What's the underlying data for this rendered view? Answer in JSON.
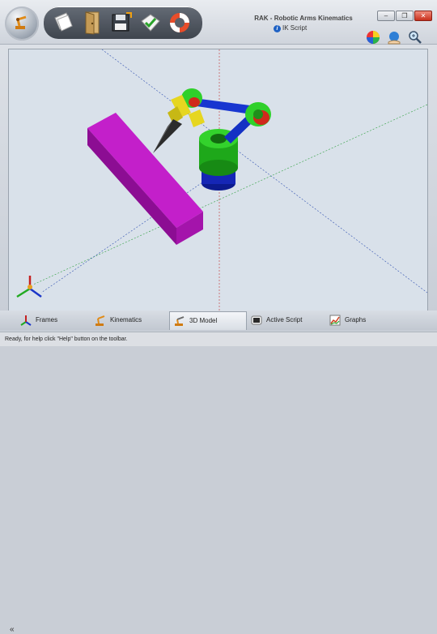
{
  "app": {
    "title": "RAK - Robotic Arms Kinematics",
    "mode": "IK Script"
  },
  "toolbar": {
    "buttons": [
      {
        "icon": "new-document-icon"
      },
      {
        "icon": "open-door-icon"
      },
      {
        "icon": "save-printer-icon"
      },
      {
        "icon": "check-arrow-icon"
      },
      {
        "icon": "lifebuoy-help-icon"
      }
    ]
  },
  "window_controls": {
    "minimize": "–",
    "restore": "❐",
    "close": "✕"
  },
  "view_tools": [
    {
      "icon": "color-wheel-icon"
    },
    {
      "icon": "globe-hand-icon"
    },
    {
      "icon": "zoom-magnifier-icon"
    }
  ],
  "tabs": {
    "scroll_left": "«",
    "items": [
      {
        "label": "Frames",
        "icon": "frames-icon",
        "active": false
      },
      {
        "label": "Kinematics",
        "icon": "kinematics-icon",
        "active": false
      },
      {
        "label": "3D Model",
        "icon": "3d-model-icon",
        "active": true
      },
      {
        "label": "Active Script",
        "icon": "active-script-icon",
        "active": false
      },
      {
        "label": "Graphs",
        "icon": "graphs-icon",
        "active": false
      }
    ]
  },
  "status": {
    "text": "Ready, for help click \"Help\" button on the toolbar."
  },
  "colors": {
    "magenta_block": "#b012b8",
    "arm_green": "#22c41a",
    "arm_blue": "#1631c8",
    "gripper_yellow": "#e0d21a",
    "viewport_bg": "#d9e1ea"
  }
}
